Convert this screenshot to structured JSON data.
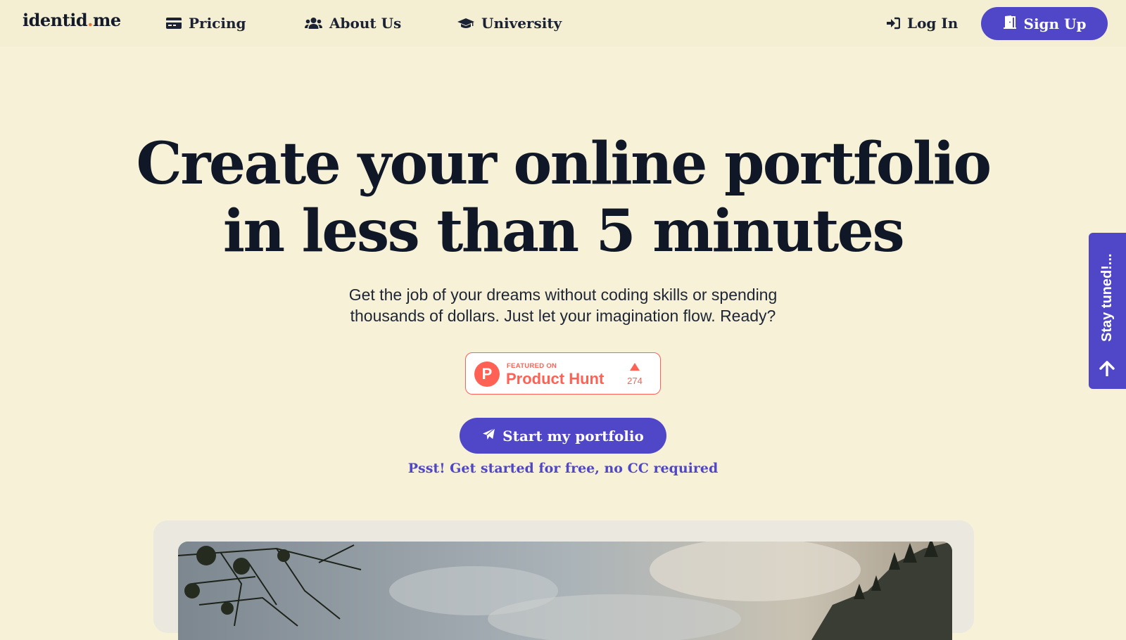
{
  "header": {
    "logo": {
      "prefix": "identid",
      "dot": ".",
      "suffix": "me"
    },
    "nav": [
      {
        "label": "Pricing",
        "icon": "credit-card-icon"
      },
      {
        "label": "About Us",
        "icon": "users-icon"
      },
      {
        "label": "University",
        "icon": "graduation-cap-icon"
      }
    ],
    "login": {
      "label": "Log In",
      "icon": "sign-in-icon"
    },
    "signup": {
      "label": "Sign Up",
      "icon": "door-open-icon"
    }
  },
  "hero": {
    "title_line1": "Create your online portfolio",
    "title_line2": "in less than 5 minutes",
    "subtitle_line1": "Get the job of your dreams without coding skills or spending",
    "subtitle_line2": "thousands of dollars. Just let your imagination flow. Ready?"
  },
  "product_hunt": {
    "featured_on": "FEATURED ON",
    "name": "Product Hunt",
    "logo_letter": "P",
    "upvotes": "274"
  },
  "cta": {
    "label": "Start my portfolio",
    "icon": "paper-plane-icon",
    "note": "Psst! Get started for free, no CC required"
  },
  "side_tab": {
    "label": "Stay tuned!...",
    "icon": "arrow-up-icon"
  },
  "colors": {
    "background": "#f7f1d8",
    "accent": "#4f46c8",
    "heading": "#101828",
    "product_hunt": "#ff6154",
    "logo_dot": "#e5763a"
  }
}
